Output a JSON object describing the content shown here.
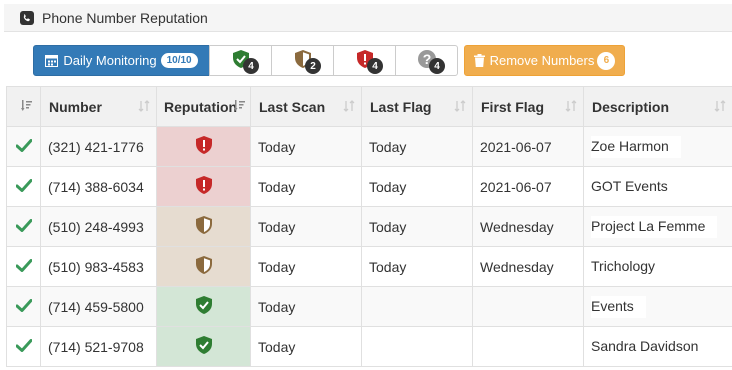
{
  "panel": {
    "title": "Phone Number Reputation",
    "icon": "phone-square-icon"
  },
  "toolbar": {
    "daily_monitoring": {
      "label": "Daily Monitoring",
      "badge": "10/10"
    },
    "filters": [
      {
        "name": "good",
        "icon": "shield-check-icon",
        "count": "4",
        "color": "#2e7d32"
      },
      {
        "name": "neutral",
        "icon": "shield-half-icon",
        "count": "2",
        "color": "#8b6a3e"
      },
      {
        "name": "bad",
        "icon": "shield-exclamation-icon",
        "count": "4",
        "color": "#c62828"
      },
      {
        "name": "unknown",
        "icon": "question-circle-icon",
        "count": "4",
        "color": "#999999"
      }
    ],
    "remove": {
      "label": "Remove Numbers",
      "badge": "6"
    }
  },
  "table": {
    "columns": [
      "Number",
      "Reputation",
      "Last Scan",
      "Last Flag",
      "First Flag",
      "Description"
    ],
    "rows": [
      {
        "number": "(321) 421-1776",
        "reputation": "bad",
        "last_scan": "Today",
        "last_flag": "Today",
        "first_flag": "2021-06-07",
        "description": "Zoe Harmon"
      },
      {
        "number": "(714) 388-6034",
        "reputation": "bad",
        "last_scan": "Today",
        "last_flag": "Today",
        "first_flag": "2021-06-07",
        "description": "GOT Events"
      },
      {
        "number": "(510) 248-4993",
        "reputation": "neutral",
        "last_scan": "Today",
        "last_flag": "Today",
        "first_flag": "Wednesday",
        "description": "Project La Femme"
      },
      {
        "number": "(510) 983-4583",
        "reputation": "neutral",
        "last_scan": "Today",
        "last_flag": "Today",
        "first_flag": "Wednesday",
        "description": "Trichology"
      },
      {
        "number": "(714) 459-5800",
        "reputation": "good",
        "last_scan": "Today",
        "last_flag": "",
        "first_flag": "",
        "description": "Events"
      },
      {
        "number": "(714) 521-9708",
        "reputation": "good",
        "last_scan": "Today",
        "last_flag": "",
        "first_flag": "",
        "description": "Sandra Davidson"
      }
    ]
  },
  "colors": {
    "primary": "#337ab7",
    "warning": "#f0ad4e",
    "check": "#3a9a5a",
    "bad_bg": "#ecd0d0",
    "neutral_bg": "#e6dcd0",
    "good_bg": "#d3e6d6"
  }
}
